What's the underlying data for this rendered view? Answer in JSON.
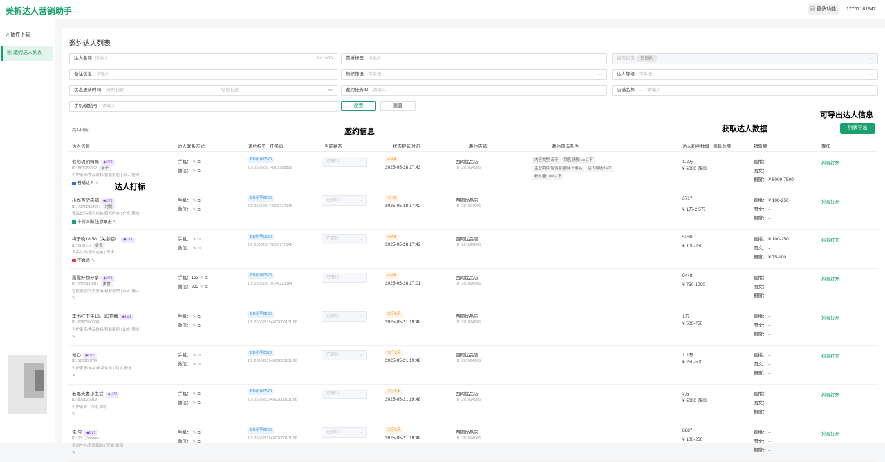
{
  "app": {
    "title": "美折达人营销助手",
    "more": "更多功能",
    "phone": "17767181947"
  },
  "sidebar": {
    "items": [
      {
        "label": "插件下载",
        "icon": "bell-icon"
      },
      {
        "label": "邀约达人列表",
        "icon": "grid-icon"
      }
    ]
  },
  "page": {
    "title": "邀约达人列表",
    "total": "共146条"
  },
  "filters": {
    "name": {
      "label": "达人名称",
      "placeholder": "请输入",
      "count": "0 / 1000"
    },
    "tag": {
      "label": "美折标签",
      "placeholder": "请输入"
    },
    "status": {
      "label": "当前状态",
      "value": "已邀约"
    },
    "note": {
      "label": "备注信息",
      "placeholder": "请输入"
    },
    "flag": {
      "label": "旗帜筛选",
      "placeholder": "可多选"
    },
    "level": {
      "label": "达人等级",
      "placeholder": "可多选"
    },
    "time": {
      "label": "状态更新时间",
      "start": "开始日期",
      "sep": "→",
      "end": "结束日期"
    },
    "task": {
      "label": "邀约任务ID",
      "placeholder": "请输入"
    },
    "shop": {
      "label": "店铺名称",
      "placeholder": "请输入"
    },
    "contact": {
      "label": "手机/微信号",
      "placeholder": "请输入"
    },
    "search": "搜索",
    "reset": "重置"
  },
  "annotations": {
    "invite": "邀约信息",
    "fetch": "获取达人数据",
    "exportable": "可导出达人信息",
    "tagging": "达人打标"
  },
  "export": "列表导出",
  "columns": [
    "达人信息",
    "达人联系方式",
    "邀约标签 | 任务ID",
    "当前状态",
    "状态更新时间",
    "邀约店铺",
    "邀约筛选条件",
    "达人粉丝数量 | 销售总额",
    "销售额",
    "操作"
  ],
  "labels": {
    "phone": "手机：",
    "wechat": "微信：",
    "live": "直播：",
    "image": "图文：",
    "window": "橱窗：",
    "open": "抖音打开",
    "select": "已邀约",
    "shop": "西网优品店",
    "shop_id": "ID: 201024966"
  },
  "rows": [
    {
      "name": "七七玥玥妈妈",
      "lv": "LV2",
      "id": "ID: 861286552",
      "cat": "亲子",
      "desc": "个护家清/食品饮料/智能家居 | 浙江·衢州",
      "flag": "普通达人",
      "flagColor": "#2f6fd6",
      "phone": "",
      "wechat": "",
      "task": "ID: 250528174305188896",
      "tasktag": "BD小李0520",
      "stat": "<24H",
      "time": "2025-05-28 17:43",
      "cond": [
        "内容类型:亲子",
        "销售总额:1w以下",
        "主营类目:智能家居/床上用品",
        "达人等级:LV2",
        "粉丝量:10w以下"
      ],
      "fans": "1.2万",
      "gmv": "¥ 5000-7500",
      "live": "-",
      "img": "-",
      "win": "¥ 5000-7500"
    },
    {
      "name": "小尚百货店铺",
      "lv": "LV1",
      "id": "ID: 71760114821",
      "cat": "时尚",
      "desc": "食品饮料/原料包装/服饰内衣 | 广东·惠州",
      "flag": "非常匹配 注意跟进",
      "flagColor": "#1aa06c",
      "phone": "",
      "wechat": "",
      "task": "ID: 250528174208737140",
      "tasktag": "BD小李0520",
      "stat": "<24H",
      "time": "2025-05-28 17:42",
      "cond": [],
      "fans": "3717",
      "gmv": "¥ 1万-2.5万",
      "live": "¥ 100-250",
      "img": "-",
      "win": "-"
    },
    {
      "name": "梅子晚18.50（关必回）",
      "lv": "LV1",
      "id": "ID: 5DRZ1I",
      "cat": "美食",
      "desc": "食品饮料/原料包装 | 天津",
      "flag": "不合适",
      "flagColor": "#e04545",
      "phone": "",
      "wechat": "",
      "task": "ID: 250528174208737140",
      "tasktag": "BD小李0520",
      "stat": "<24H",
      "time": "2025-05-28 17:42",
      "cond": [],
      "fans": "5250",
      "gmv": "¥ 100-250",
      "live": "¥ 100-250",
      "img": "-",
      "win": "¥ 75-100"
    },
    {
      "name": "霞霞好物分享",
      "lv": "LV1",
      "id": "ID: 2209419811",
      "cat": "美食",
      "desc": "智能家居/个护家清/母婴宠物 | 江苏·镇江",
      "flag": "",
      "flagColor": "",
      "phone": "123",
      "wechat": "222",
      "task": "ID: 250528170146225384",
      "tasktag": "BD小李0520",
      "stat": "<24H",
      "time": "2025-05-28 17:01",
      "cond": [],
      "fans": "9448",
      "gmv": "¥ 750-1000",
      "live": "-",
      "img": "-",
      "win": "-"
    },
    {
      "name": "李书红下午13。15开播",
      "lv": "LV1",
      "id": "ID: 62609500941",
      "cat": "",
      "desc": "个护家清/食品饮料/智能家居 | 山东·德州",
      "flag": "",
      "flagColor": "",
      "phone": "",
      "wechat": "",
      "task": "ID: 250521194802000101 66",
      "tasktag": "BD小李0520",
      "stat": "大于1天",
      "time": "2025-05-21 19:48",
      "cond": [],
      "fans": "1万",
      "gmv": "¥ 500-750",
      "live": "-",
      "img": "-",
      "win": "-"
    },
    {
      "name": "倾心",
      "lv": "LV1",
      "id": "ID: 107900704",
      "cat": "",
      "desc": "个护家清/美妆/食品饮料 | 河北·衡水",
      "flag": "",
      "flagColor": "",
      "phone": "",
      "wechat": "",
      "task": "ID: 250521194802000101 66",
      "tasktag": "BD小李0520",
      "stat": "大于1天",
      "time": "2025-05-21 19:48",
      "cond": [],
      "fans": "1.2万",
      "gmv": "¥ 250-500",
      "live": "-",
      "img": "-",
      "win": "-"
    },
    {
      "name": "老黑夫妻小生活",
      "lv": "LV2",
      "id": "ID: 879026919",
      "cat": "",
      "desc": "个护家清 | 河北·廊坊",
      "flag": "",
      "flagColor": "",
      "phone": "",
      "wechat": "",
      "task": "ID: 250521194802000101 66",
      "tasktag": "BD小李0520",
      "stat": "大于1天",
      "time": "2025-05-21 19:48",
      "cond": [],
      "fans": "3万",
      "gmv": "¥ 5000-7500",
      "live": "-",
      "img": "-",
      "win": "-"
    },
    {
      "name": "朱 宝",
      "lv": "LV1",
      "id": "ID: ZYJ_Yxxxxx",
      "cat": "",
      "desc": "运动户外/鞋靴箱包 | 安徽·阜阳",
      "flag": "",
      "flagColor": "",
      "phone": "",
      "wechat": "",
      "task": "ID: 250521194802000101 66",
      "tasktag": "BD小李0520",
      "stat": "大于1天",
      "time": "2025-05-21 19:48",
      "cond": [],
      "fans": "8887",
      "gmv": "¥ 100-250",
      "live": "-",
      "img": "-",
      "win": "-"
    }
  ]
}
